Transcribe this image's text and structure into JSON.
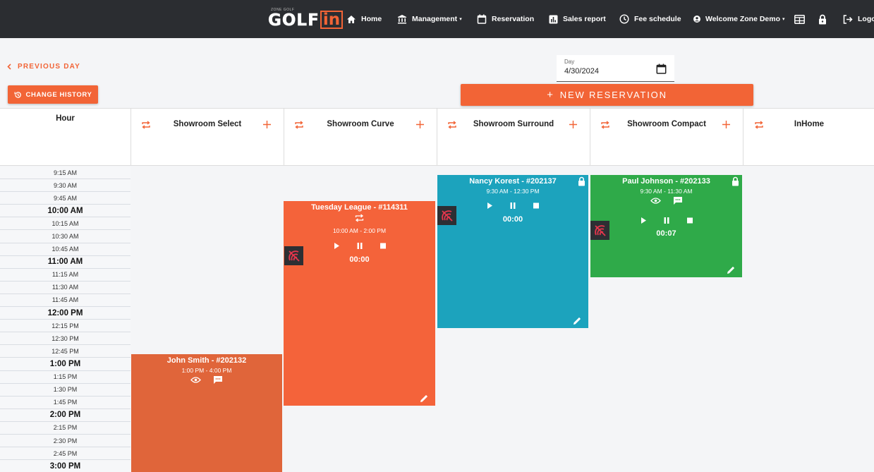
{
  "brand": {
    "top_text": "ZONE GOLF",
    "word": "GOLF",
    "word_accent": "in"
  },
  "nav": {
    "home": "Home",
    "management": "Management",
    "reservation": "Reservation",
    "sales_report": "Sales report",
    "fee_schedule": "Fee schedule",
    "welcome": "Welcome Zone Demo",
    "logout": "Logo"
  },
  "controls": {
    "previous_day": "PREVIOUS DAY",
    "change_history": "CHANGE HISTORY",
    "day_label": "Day",
    "day_value": "4/30/2024",
    "new_reservation": "NEW RESERVATION"
  },
  "grid": {
    "hour_header": "Hour",
    "rooms": [
      "Showroom Select",
      "Showroom Curve",
      "Showroom Surround",
      "Showroom Compact",
      "InHome"
    ],
    "times": [
      {
        "label": "9:15 AM",
        "major": false
      },
      {
        "label": "9:30 AM",
        "major": false
      },
      {
        "label": "9:45 AM",
        "major": false
      },
      {
        "label": "10:00 AM",
        "major": true
      },
      {
        "label": "10:15 AM",
        "major": false
      },
      {
        "label": "10:30 AM",
        "major": false
      },
      {
        "label": "10:45 AM",
        "major": false
      },
      {
        "label": "11:00 AM",
        "major": true
      },
      {
        "label": "11:15 AM",
        "major": false
      },
      {
        "label": "11:30 AM",
        "major": false
      },
      {
        "label": "11:45 AM",
        "major": false
      },
      {
        "label": "12:00 PM",
        "major": true
      },
      {
        "label": "12:15 PM",
        "major": false
      },
      {
        "label": "12:30 PM",
        "major": false
      },
      {
        "label": "12:45 PM",
        "major": false
      },
      {
        "label": "1:00 PM",
        "major": true
      },
      {
        "label": "1:15 PM",
        "major": false
      },
      {
        "label": "1:30 PM",
        "major": false
      },
      {
        "label": "1:45 PM",
        "major": false
      },
      {
        "label": "2:00 PM",
        "major": true
      },
      {
        "label": "2:15 PM",
        "major": false
      },
      {
        "label": "2:30 PM",
        "major": false
      },
      {
        "label": "2:45 PM",
        "major": false
      },
      {
        "label": "3:00 PM",
        "major": true
      }
    ]
  },
  "reservations": {
    "john": {
      "title": "John Smith - #202132",
      "time": "1:00 PM - 4:00 PM",
      "color": "#e0653a"
    },
    "tuesday": {
      "title": "Tuesday League - #114311",
      "time": "10:00 AM - 2:00 PM",
      "timer": "00:00",
      "color": "#f4633a"
    },
    "nancy": {
      "title": "Nancy Korest - #202137",
      "time": "9:30 AM - 12:30 PM",
      "timer": "00:00",
      "color": "#1ca3bd"
    },
    "paul": {
      "title": "Paul Johnson - #202133",
      "time": "9:30 AM - 11:30 AM",
      "timer": "00:07",
      "color": "#2faa49"
    }
  },
  "colors": {
    "accent": "#f26436",
    "navbar": "#2b2d31",
    "nosignal_bg": "#2d2f33",
    "nosignal_icon": "#e8364d"
  }
}
